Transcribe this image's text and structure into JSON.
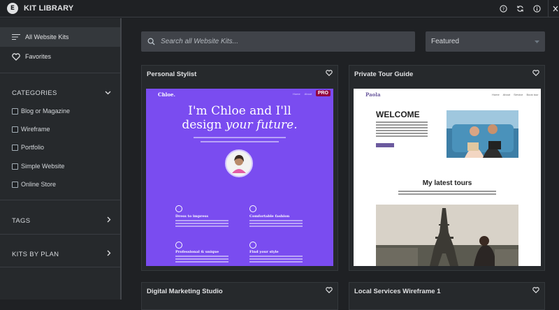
{
  "app": {
    "title": "KIT LIBRARY"
  },
  "sidebar": {
    "all_kits": "All Website Kits",
    "favorites": "Favorites",
    "categories_label": "CATEGORIES",
    "categories": [
      "Blog or Magazine",
      "Wireframe",
      "Portfolio",
      "Simple Website",
      "Online Store"
    ],
    "tags_label": "TAGS",
    "kits_by_plan_label": "KITS BY PLAN"
  },
  "search": {
    "placeholder": "Search all Website Kits..."
  },
  "sort": {
    "selected": "Featured"
  },
  "kits": [
    {
      "name": "Personal Stylist",
      "badge": "PRO",
      "preview": {
        "brand": "Chloe.",
        "nav": [
          "Home",
          "About",
          "Blog"
        ],
        "headline_1": "I'm Chloe and I'll",
        "headline_2a": "design ",
        "headline_2b": "your future.",
        "features": [
          "Dress to impress",
          "Comfortable fashion",
          "Professional & unique",
          "Find your style"
        ]
      }
    },
    {
      "name": "Private Tour Guide",
      "preview": {
        "brand": "Paola",
        "nav": [
          "Home",
          "About",
          "Service",
          "Book tour"
        ],
        "welcome": "WELCOME",
        "latest": "My latest tours"
      }
    },
    {
      "name": "Digital Marketing Studio"
    },
    {
      "name": "Local Services Wireframe 1"
    }
  ],
  "colors": {
    "accent_purple": "#7a4cf0",
    "pro_badge": "#93003f",
    "bg": "#1f2124",
    "sidebar": "#26292c"
  }
}
